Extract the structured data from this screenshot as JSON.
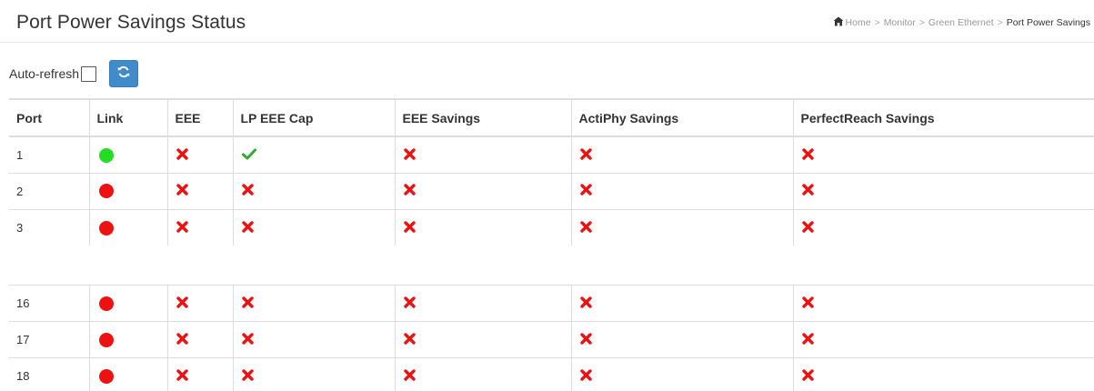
{
  "header": {
    "title": "Port Power Savings Status",
    "breadcrumb": [
      "Home",
      "Monitor",
      "Green Ethernet",
      "Port Power Savings"
    ]
  },
  "toolbar": {
    "auto_refresh_label": "Auto-refresh",
    "auto_refresh_checked": false,
    "refresh_icon": "refresh-icon"
  },
  "table": {
    "columns": [
      "Port",
      "Link",
      "EEE",
      "LP EEE Cap",
      "EEE Savings",
      "ActiPhy Savings",
      "PerfectReach Savings"
    ],
    "status_colors": {
      "link_up": "#22dd22",
      "link_down": "#ee1111",
      "no": "#ee1111",
      "yes": "#33aa33"
    },
    "rows_top": [
      {
        "port": "1",
        "link": "up",
        "eee": "no",
        "lp_eee_cap": "yes",
        "eee_savings": "no",
        "actiphy": "no",
        "perfectreach": "no"
      },
      {
        "port": "2",
        "link": "down",
        "eee": "no",
        "lp_eee_cap": "no",
        "eee_savings": "no",
        "actiphy": "no",
        "perfectreach": "no"
      },
      {
        "port": "3",
        "link": "down",
        "eee": "no",
        "lp_eee_cap": "no",
        "eee_savings": "no",
        "actiphy": "no",
        "perfectreach": "no"
      }
    ],
    "rows_bottom": [
      {
        "port": "16",
        "link": "down",
        "eee": "no",
        "lp_eee_cap": "no",
        "eee_savings": "no",
        "actiphy": "no",
        "perfectreach": "no"
      },
      {
        "port": "17",
        "link": "down",
        "eee": "no",
        "lp_eee_cap": "no",
        "eee_savings": "no",
        "actiphy": "no",
        "perfectreach": "no"
      },
      {
        "port": "18",
        "link": "down",
        "eee": "no",
        "lp_eee_cap": "no",
        "eee_savings": "no",
        "actiphy": "no",
        "perfectreach": "no"
      }
    ]
  }
}
